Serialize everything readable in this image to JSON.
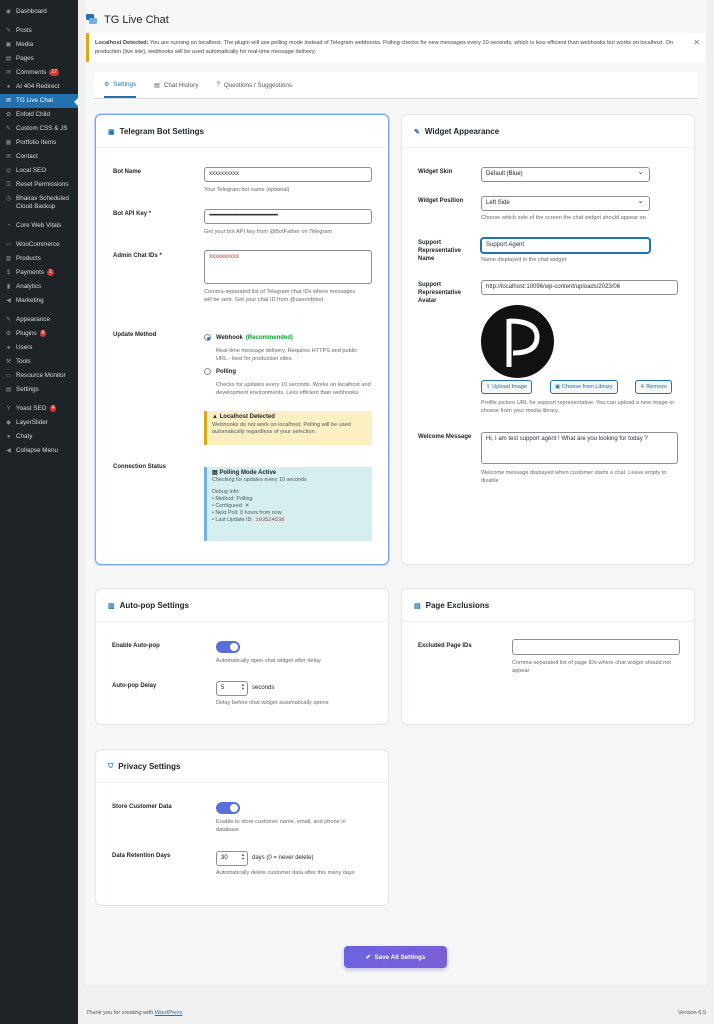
{
  "sidebar": {
    "items": [
      {
        "icon": "dashboard-icon",
        "glyph": "◉",
        "label": "Dashboard"
      },
      {
        "sep": true
      },
      {
        "icon": "pin-icon",
        "glyph": "✎",
        "label": "Posts"
      },
      {
        "icon": "media-icon",
        "glyph": "▣",
        "label": "Media"
      },
      {
        "icon": "pages-icon",
        "glyph": "▤",
        "label": "Pages"
      },
      {
        "icon": "comments-icon",
        "glyph": "✉",
        "label": "Comments",
        "badge": "17"
      },
      {
        "icon": "redirect-icon",
        "glyph": "●",
        "label": "AI 404 Redirect"
      },
      {
        "icon": "chat-icon",
        "glyph": "✉",
        "label": "TG Live Chat",
        "active": true
      },
      {
        "icon": "child-icon",
        "glyph": "✿",
        "label": "Enfold Child"
      },
      {
        "icon": "code-icon",
        "glyph": "✎",
        "label": "Custom CSS & JS"
      },
      {
        "icon": "portfolio-icon",
        "glyph": "▦",
        "label": "Portfolio Items"
      },
      {
        "icon": "contact-icon",
        "glyph": "✉",
        "label": "Contact"
      },
      {
        "icon": "seo-icon",
        "glyph": "◎",
        "label": "Local SEO"
      },
      {
        "icon": "lock-icon",
        "glyph": "⚿",
        "label": "Reset Permissions"
      },
      {
        "icon": "clock-icon",
        "glyph": "◷",
        "label": "Bhairav Scheduled Cloud Backup"
      },
      {
        "sep": true
      },
      {
        "icon": "vitals-icon",
        "glyph": "◔",
        "label": "Core Web Vitals"
      },
      {
        "sep": true
      },
      {
        "icon": "woo-icon",
        "glyph": "▭",
        "label": "WooCommerce"
      },
      {
        "icon": "products-icon",
        "glyph": "▥",
        "label": "Products"
      },
      {
        "icon": "payments-icon",
        "glyph": "$",
        "label": "Payments",
        "badge": "1"
      },
      {
        "icon": "analytics-icon",
        "glyph": "▮",
        "label": "Analytics"
      },
      {
        "icon": "marketing-icon",
        "glyph": "◀",
        "label": "Marketing"
      },
      {
        "sep": true
      },
      {
        "icon": "appearance-icon",
        "glyph": "✎",
        "label": "Appearance"
      },
      {
        "icon": "plugins-icon",
        "glyph": "⚙",
        "label": "Plugins",
        "badge": "6"
      },
      {
        "icon": "users-icon",
        "glyph": "●",
        "label": "Users"
      },
      {
        "icon": "tools-icon",
        "glyph": "⚒",
        "label": "Tools"
      },
      {
        "icon": "monitor-icon",
        "glyph": "▭",
        "label": "Resource Monitor"
      },
      {
        "icon": "settings-icon",
        "glyph": "▤",
        "label": "Settings"
      },
      {
        "sep": true
      },
      {
        "icon": "yoast-icon",
        "glyph": "Y",
        "label": "Yoast SEO",
        "badge": "4"
      },
      {
        "icon": "layerslider-icon",
        "glyph": "◆",
        "label": "LayerSlider"
      },
      {
        "icon": "chaty-icon",
        "glyph": "●",
        "label": "Chaty"
      },
      {
        "icon": "collapse-icon",
        "glyph": "◀",
        "label": "Collapse Menu"
      }
    ]
  },
  "page": {
    "title": "TG Live Chat",
    "notice_bold": "Localhost Detected:",
    "notice_text": " You are running on localhost. The plugin will use polling mode instead of Telegram webhooks. Polling checks for new messages every 10 seconds, which is less efficient than webhooks but works on localhost. On production (live site), webhooks will be used automatically for real-time message delivery.",
    "dismiss": "✕"
  },
  "tabs": [
    {
      "icon": "gear-icon",
      "glyph": "⚙",
      "label": "Settings",
      "active": true
    },
    {
      "icon": "history-icon",
      "glyph": "▤",
      "label": "Chat History"
    },
    {
      "icon": "question-icon",
      "glyph": "?",
      "label": "Questions / Suggestions"
    }
  ],
  "telegram": {
    "title": "Telegram Bot Settings",
    "bot_name_label": "Bot Name",
    "bot_name_value": "xxxxxxxxxx",
    "bot_name_desc": "Your Telegram bot name (optional)",
    "api_key_label": "Bot API Key *",
    "api_key_value": "••••••••••••••••••••••••••••••••••••••••••••••••••••••••••••••",
    "api_key_desc": "Get your bot API key from @BotFather on Telegram",
    "chat_ids_label": "Admin Chat IDs *",
    "chat_ids_value": "xxxxxxxxxx",
    "chat_ids_desc": "Comma-separated list of Telegram chat IDs where messages will be sent. Get your chat ID from @userinfobot",
    "method_label": "Update Method",
    "webhook_label": "Webhook",
    "webhook_tag": "(Recommended)",
    "webhook_desc": "Real-time message delivery. Requires HTTPS and public URL - best for production sites.",
    "polling_label": "Polling",
    "polling_desc": "Checks for updates every 10 seconds. Works on localhost and development environments. Less efficient than webhooks.",
    "warn_title": "Localhost Detected",
    "warn_text": "Webhooks do not work on localhost. Polling will be used automatically regardless of your selection.",
    "status_label": "Connection Status",
    "status_title": "Polling Mode Active",
    "status_sub": "Checking for updates every 10 seconds",
    "debug_title": "Debug Info:",
    "debug_1": "• Method: Polling",
    "debug_2": "• Configured: ✕",
    "debug_3": "• Next Poll: 0 hours from now",
    "debug_4_label": "• Last Update ID:",
    "debug_4_value": "193524536"
  },
  "widget": {
    "title": "Widget Appearance",
    "skin_label": "Widget Skin",
    "skin_value": "Default (Blue)",
    "position_label": "Widget Position",
    "position_value": "Left Side",
    "position_desc": "Choose which side of the screen the chat widget should appear on",
    "rep_name_label": "Support Representative Name",
    "rep_name_value": "Support Agent",
    "rep_name_desc": "Name displayed in the chat widget",
    "avatar_label": "Support Representative Avatar",
    "avatar_value": "http://localhost:10096/wp-content/uploads/2023/06",
    "avatar_letter": "P",
    "upload_btn": "Upload Image",
    "library_btn": "Choose from Library",
    "remove_btn": "Remove",
    "avatar_desc": "Profile picture URL for support representative. You can upload a new image or choose from your media library.",
    "welcome_label": "Welcome Message",
    "welcome_value": "Hi, I am test support agent ! What are you looking for today ?",
    "welcome_desc": "Welcome message displayed when customer starts a chat. Leave empty to disable"
  },
  "autopop": {
    "title": "Auto-pop Settings",
    "enable_label": "Enable Auto-pop",
    "enable_desc": "Automatically open chat widget after delay",
    "delay_label": "Auto-pop Delay",
    "delay_value": "5",
    "delay_suffix": "seconds",
    "delay_desc": "Delay before chat widget automatically opens"
  },
  "exclusions": {
    "title": "Page Exclusions",
    "ids_label": "Excluded Page IDs",
    "ids_desc": "Comma-separated list of page IDs where chat widget should not appear"
  },
  "privacy": {
    "title": "Privacy Settings",
    "store_label": "Store Customer Data",
    "store_desc": "Enable to store customer name, email, and phone in database",
    "retention_label": "Data Retention Days",
    "retention_value": "30",
    "retention_suffix": "days (0 = never delete)",
    "retention_desc": "Automatically delete customer data after this many days"
  },
  "save_label": "Save All Settings",
  "footer": {
    "thanks": "Thank you for creating with ",
    "link": "WordPress",
    "version": "Version 6.9"
  }
}
